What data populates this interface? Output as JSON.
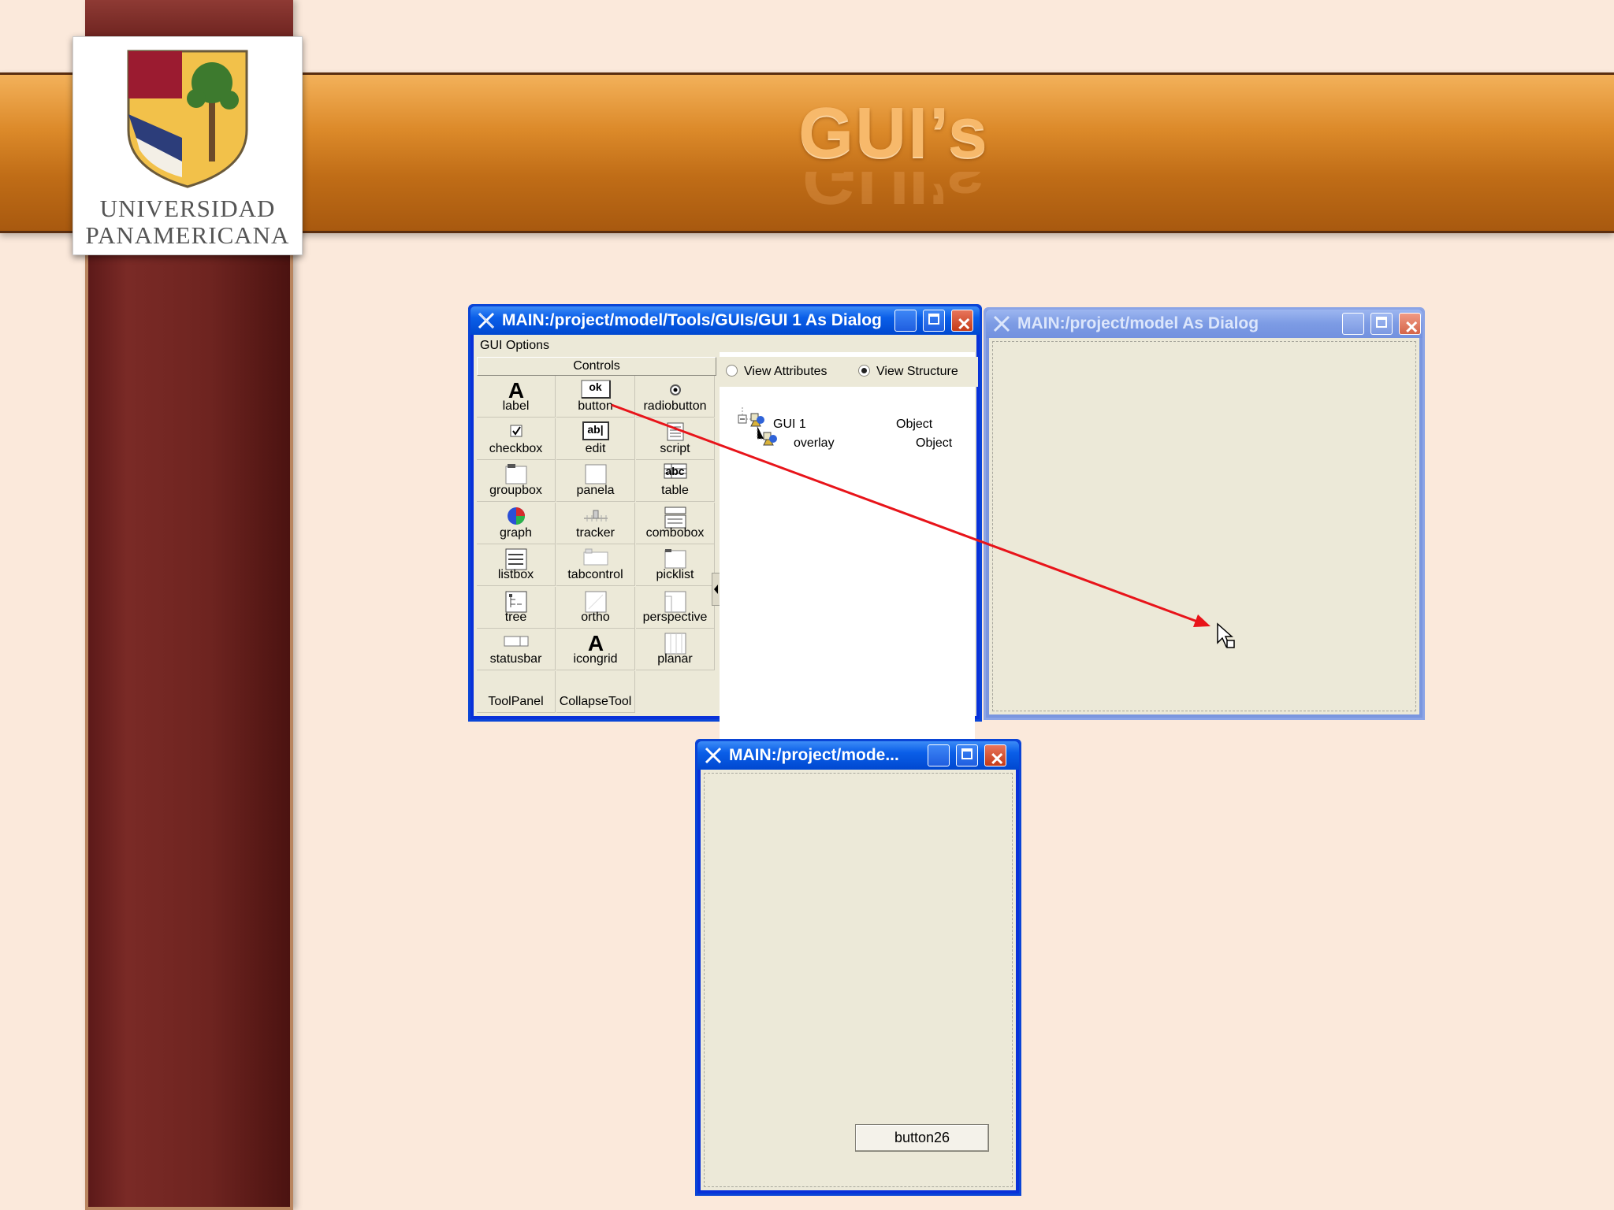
{
  "slide": {
    "title": "GUI’s",
    "logo_line1": "UNIVERSIDAD",
    "logo_line2": "PANAMERICANA"
  },
  "window_main": {
    "title": "MAIN:/project/model/Tools/GUIs/GUI 1 As Dialog",
    "menu": "GUI Options",
    "controls_header": "Controls",
    "controls": [
      {
        "label": "label",
        "icon": "label-icon"
      },
      {
        "label": "button",
        "icon": "button-icon",
        "icon_text": "ok"
      },
      {
        "label": "radiobutton",
        "icon": "radiobutton-icon"
      },
      {
        "label": "checkbox",
        "icon": "checkbox-icon"
      },
      {
        "label": "edit",
        "icon": "edit-icon",
        "icon_text": "ab|"
      },
      {
        "label": "script",
        "icon": "script-icon"
      },
      {
        "label": "groupbox",
        "icon": "groupbox-icon"
      },
      {
        "label": "panela",
        "icon": "panel-icon"
      },
      {
        "label": "table",
        "icon": "table-icon",
        "icon_text": "abc"
      },
      {
        "label": "graph",
        "icon": "graph-icon"
      },
      {
        "label": "tracker",
        "icon": "tracker-icon"
      },
      {
        "label": "combobox",
        "icon": "combobox-icon"
      },
      {
        "label": "listbox",
        "icon": "listbox-icon"
      },
      {
        "label": "tabcontrol",
        "icon": "tabcontrol-icon"
      },
      {
        "label": "picklist",
        "icon": "picklist-icon"
      },
      {
        "label": "tree",
        "icon": "tree-icon"
      },
      {
        "label": "ortho",
        "icon": "ortho-icon"
      },
      {
        "label": "perspective",
        "icon": "perspective-icon"
      },
      {
        "label": "statusbar",
        "icon": "statusbar-icon"
      },
      {
        "label": "icongrid",
        "icon": "icongrid-icon"
      },
      {
        "label": "planar",
        "icon": "planar-icon"
      },
      {
        "label": "ToolPanel",
        "icon": ""
      },
      {
        "label": "CollapseTool",
        "icon": ""
      }
    ],
    "view_attributes": "View Attributes",
    "view_structure": "View Structure",
    "view_selected": "View Structure",
    "tree": [
      {
        "name": "GUI 1",
        "type": "Object"
      },
      {
        "name": "overlay",
        "type": "Object"
      }
    ]
  },
  "window_model": {
    "title": "MAIN:/project/model As Dialog"
  },
  "window_preview": {
    "title": "MAIN:/project/mode...",
    "button_label": "button26"
  },
  "colors": {
    "titlebar_active": "#0a5ee8",
    "titlebar_inactive": "#7c9be4",
    "drag_arrow": "#e8141a",
    "dialog_face": "#ece9d8"
  }
}
